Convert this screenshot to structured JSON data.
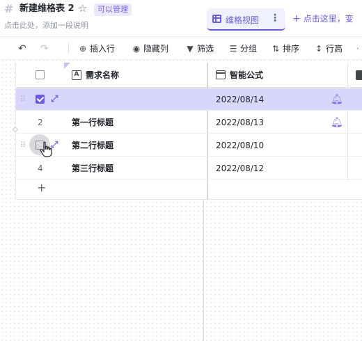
{
  "header": {
    "title": "新建维格表 2",
    "badge": "可以管理",
    "description": "点击此处，添加一段说明"
  },
  "views": {
    "active_tab": "维格视图",
    "more_label": "⋮",
    "add_view_label": "点击这里，变"
  },
  "toolbar": {
    "items": [
      {
        "label": "插入行",
        "icon": "plus-circle-icon"
      },
      {
        "label": "隐藏列",
        "icon": "eye-icon"
      },
      {
        "label": "筛选",
        "icon": "filter-icon"
      },
      {
        "label": "分组",
        "icon": "group-icon"
      },
      {
        "label": "排序",
        "icon": "sort-icon"
      },
      {
        "label": "行高",
        "icon": "row-height-icon"
      }
    ]
  },
  "table": {
    "columns": [
      {
        "name": "需求名称",
        "icon": "text-field-icon"
      },
      {
        "name": "智能公式",
        "icon": "calendar-icon"
      }
    ],
    "rows": [
      {
        "num": "",
        "title": "",
        "date": "2022/08/14",
        "selected": true,
        "reminder": true
      },
      {
        "num": "2",
        "title": "第一行标题",
        "date": "2022/08/13",
        "selected": false,
        "reminder": true
      },
      {
        "num": "",
        "title": "第二行标题",
        "date": "2022/08/10",
        "selected": false,
        "reminder": false
      },
      {
        "num": "4",
        "title": "第三行标题",
        "date": "2022/08/12",
        "selected": false,
        "reminder": false
      }
    ],
    "add_row_label": "+"
  },
  "colors": {
    "accent": "#6b5ce7",
    "selected_row": "#d9d6fb"
  }
}
